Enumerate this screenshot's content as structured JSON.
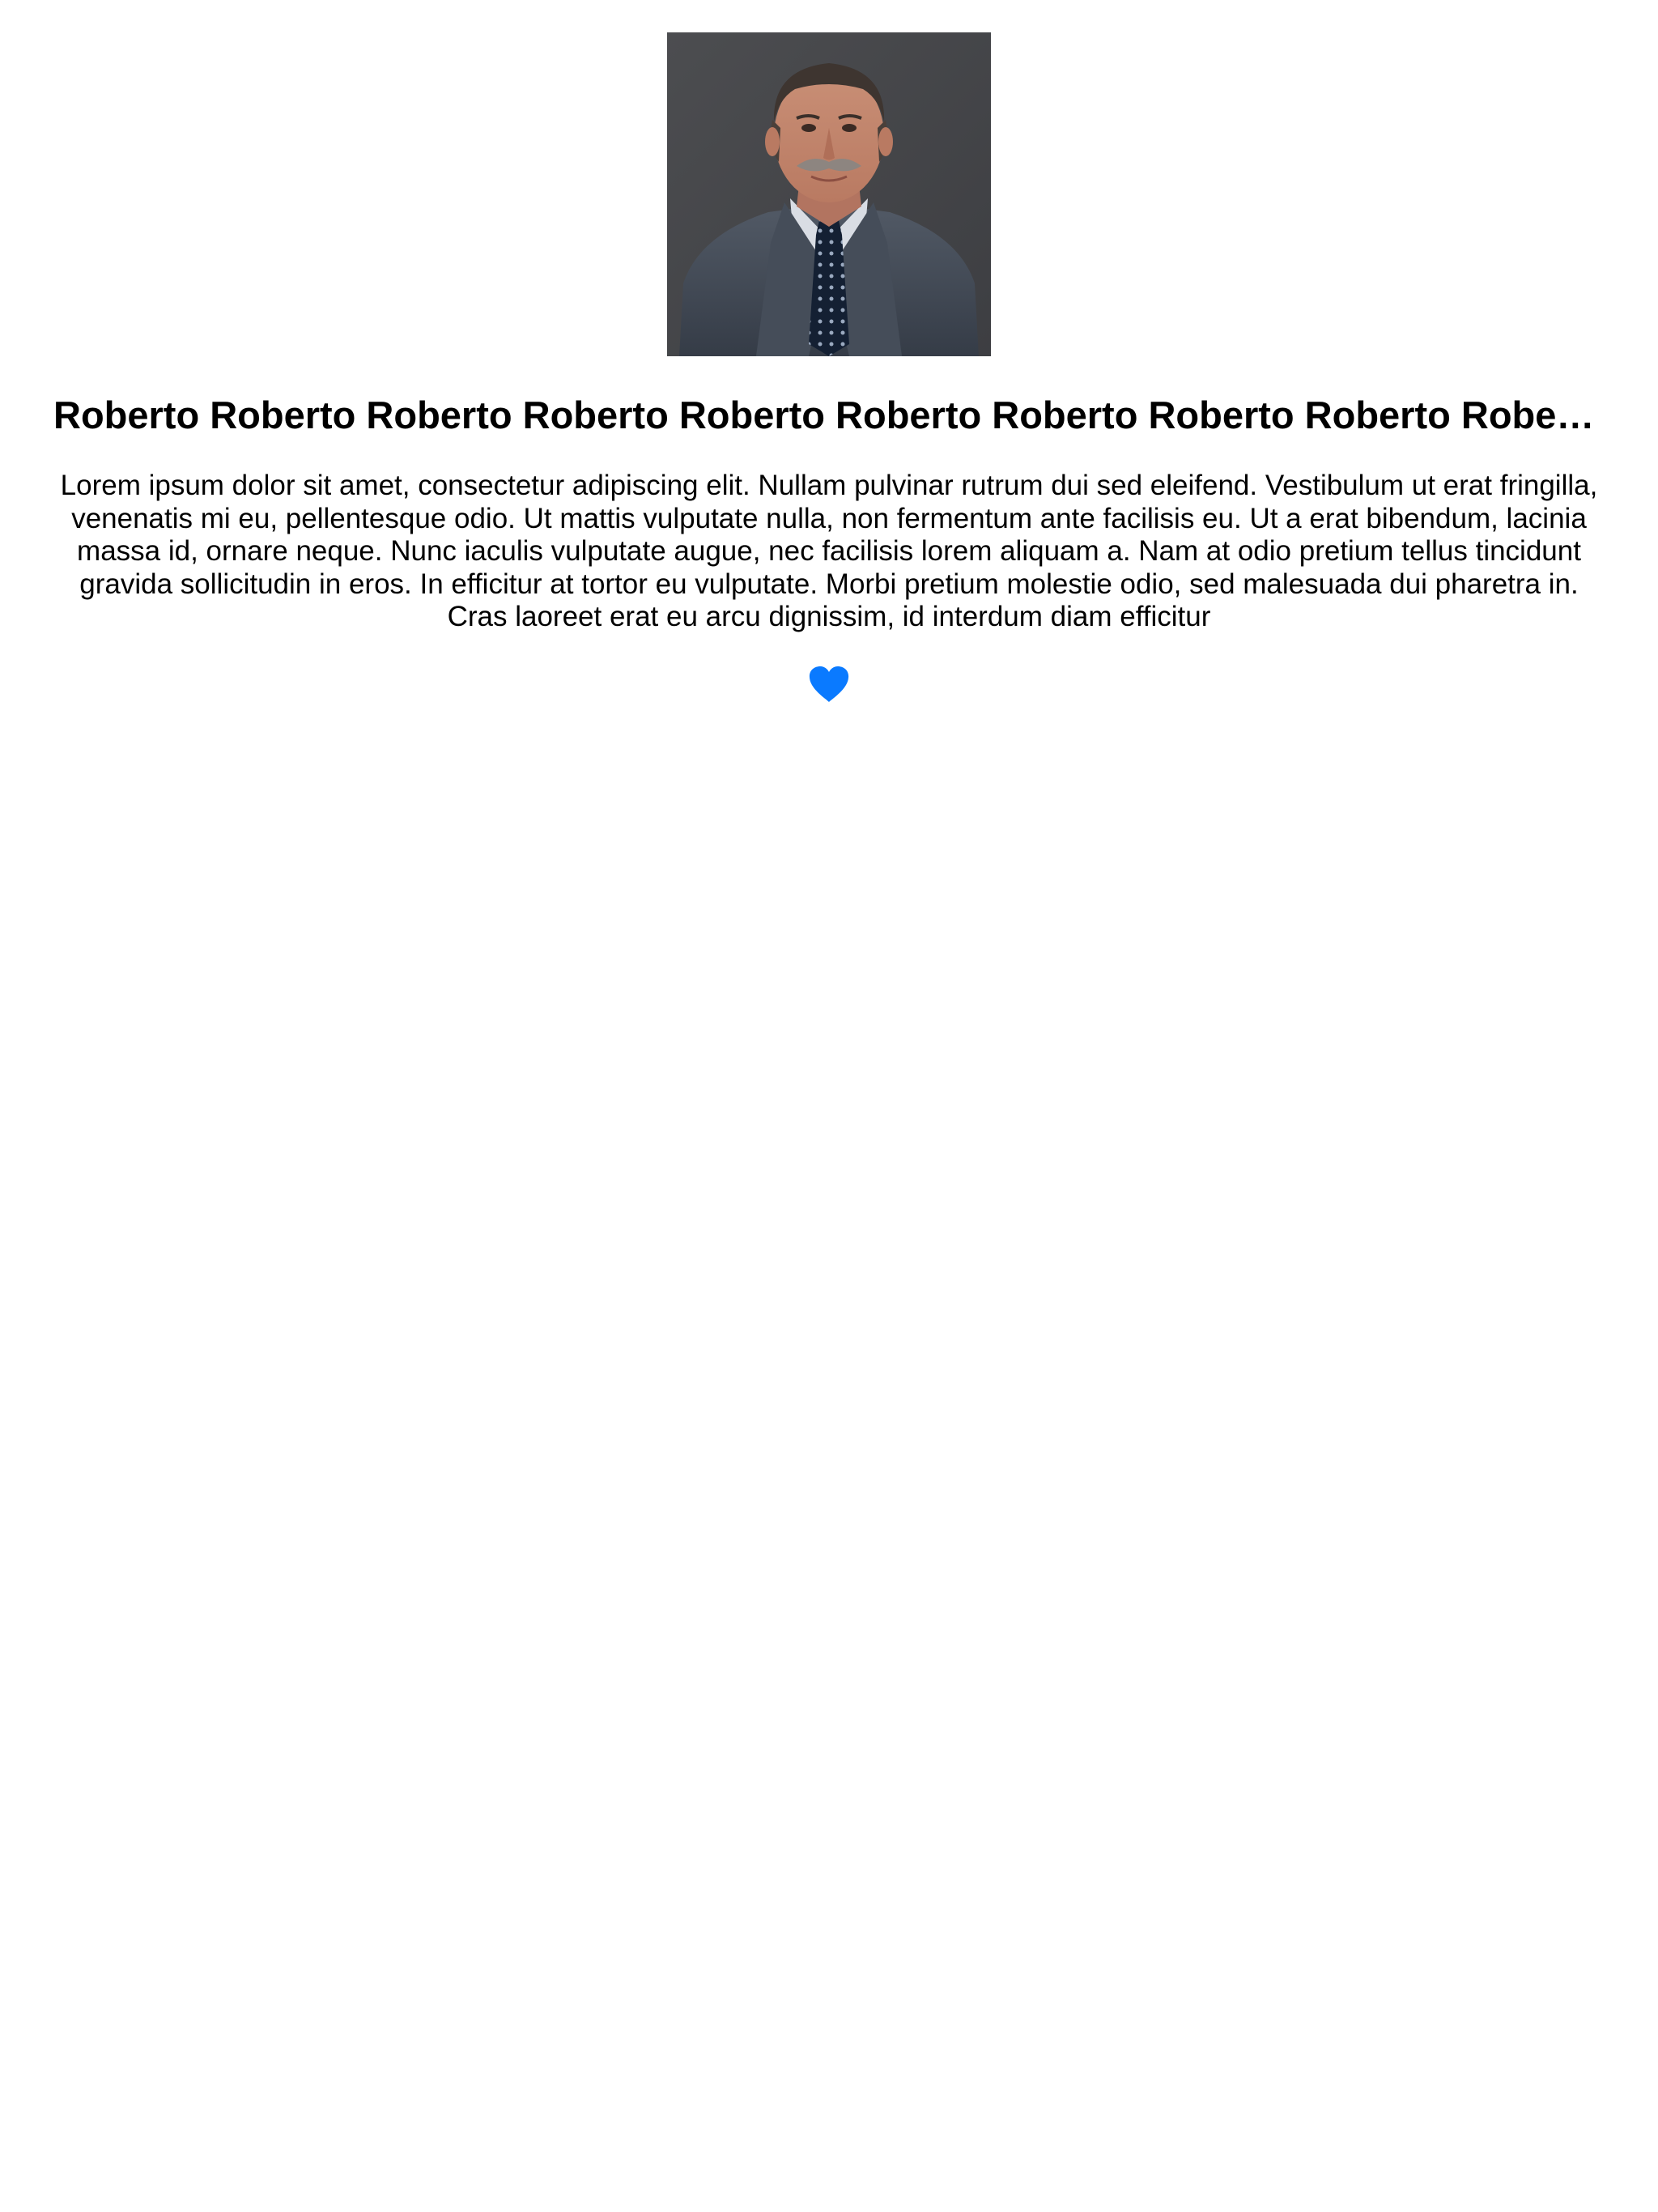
{
  "profile": {
    "photo_alt": "Portrait of Roberto",
    "name": "Roberto Roberto Roberto Roberto Roberto Roberto Roberto Roberto Roberto Roberto Roberto Roberto",
    "bio": "Lorem ipsum dolor sit amet, consectetur adipiscing elit. Nullam pulvinar rutrum dui sed eleifend. Vestibulum ut erat fringilla, venenatis mi eu, pellentesque odio. Ut mattis vulputate nulla, non fermentum ante facilisis eu. Ut a erat bibendum, lacinia massa id, ornare neque. Nunc iaculis vulputate augue, nec facilisis lorem aliquam a. Nam at odio pretium tellus tincidunt gravida sollicitudin in eros. In efficitur at tortor eu vulputate. Morbi pretium molestie odio, sed malesuada dui pharetra in. Cras laoreet erat eu arcu dignissim, id interdum diam efficitur",
    "like_icon": "heart-filled-icon",
    "like_color": "#0A7AFF"
  }
}
